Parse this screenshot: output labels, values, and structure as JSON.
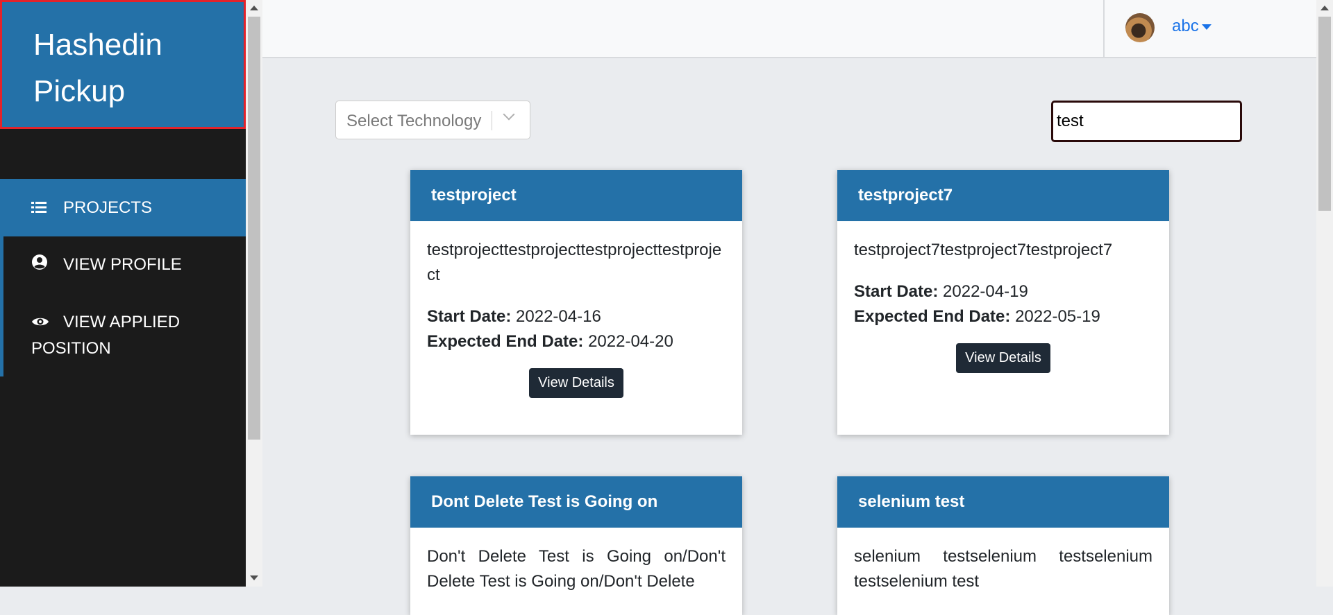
{
  "brand": {
    "line1": "Hashedin",
    "line2": "Pickup"
  },
  "sidebar": {
    "items": [
      {
        "label": "PROJECTS",
        "icon": "list-icon"
      },
      {
        "label": "VIEW PROFILE",
        "icon": "user-circle-icon"
      },
      {
        "label": "VIEW APPLIED POSITION",
        "icon": "eye-icon"
      }
    ]
  },
  "header": {
    "username": "abc"
  },
  "filters": {
    "technology_placeholder": "Select Technology",
    "search_value": "test"
  },
  "labels": {
    "start_date": "Start Date:",
    "end_date": "Expected End Date:",
    "view_details": "View Details"
  },
  "projects": [
    {
      "title": "testproject",
      "description": "testprojecttestprojecttestprojecttestproject",
      "start_date": "2022-04-16",
      "end_date": "2022-04-20"
    },
    {
      "title": "testproject7",
      "description": "testproject7testproject7testproject7",
      "start_date": "2022-04-19",
      "end_date": "2022-05-19"
    },
    {
      "title": "Dont Delete Test is Going on",
      "description": "Don't Delete Test is Going on/Don't Delete Test is Going on/Don't Delete"
    },
    {
      "title": "selenium test",
      "description": "selenium testselenium testselenium testselenium test"
    }
  ],
  "colors": {
    "primary": "#2471a8",
    "sidebar_bg": "#1b1b1b",
    "brand_border": "#e3232b",
    "button_bg": "#1f2a36",
    "link": "#1a73e8"
  }
}
